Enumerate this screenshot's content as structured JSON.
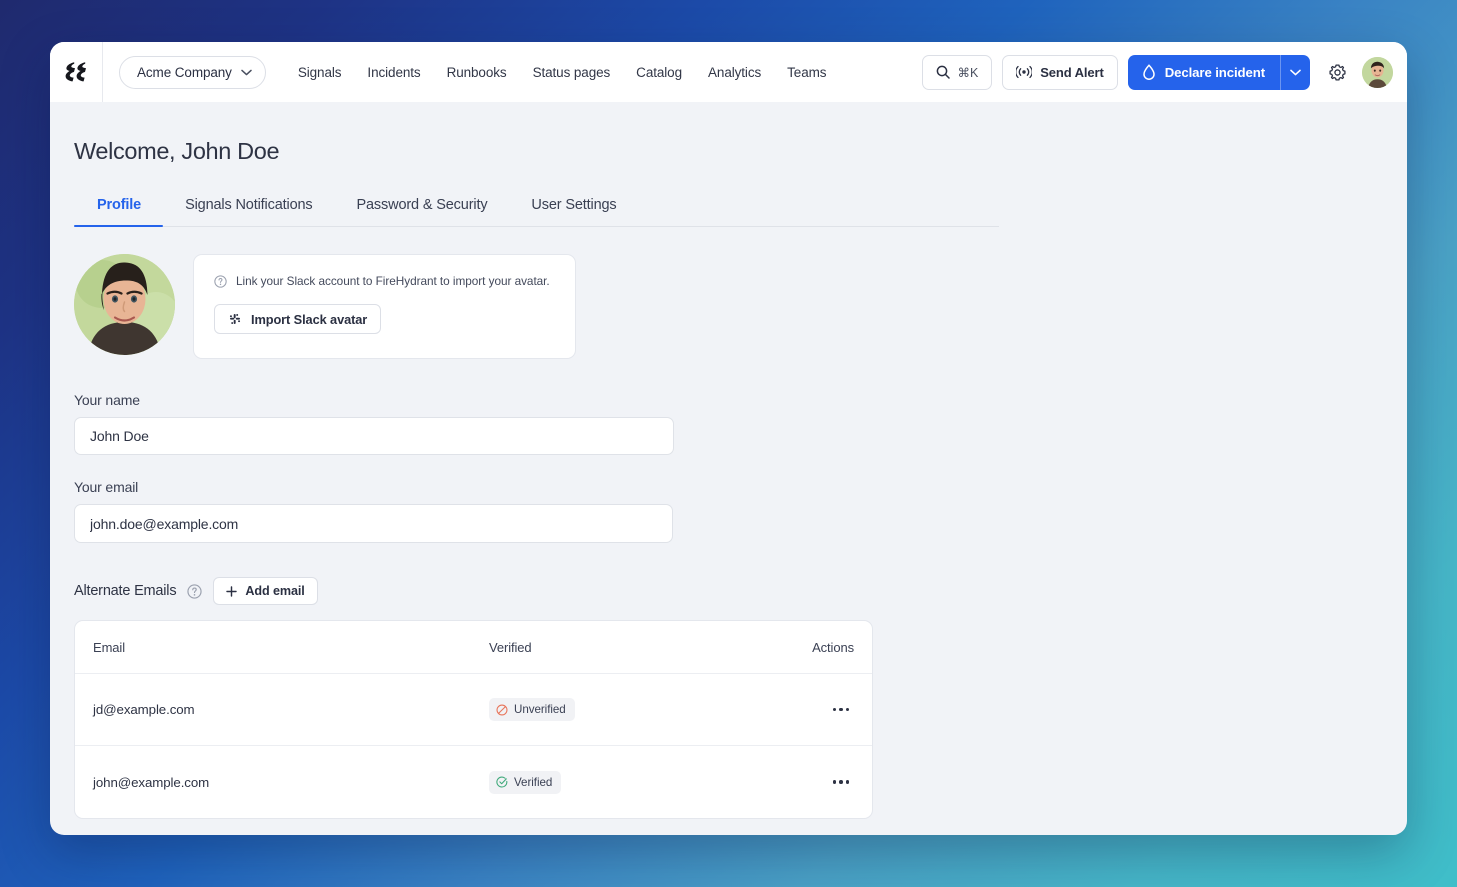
{
  "topnav": {
    "logo_name": "firehydrant-logo",
    "org_switcher": {
      "label": "Acme Company",
      "caret_icon": "chevron-down-icon"
    },
    "links": [
      {
        "label": "Signals"
      },
      {
        "label": "Incidents"
      },
      {
        "label": "Runbooks"
      },
      {
        "label": "Status pages"
      },
      {
        "label": "Catalog"
      },
      {
        "label": "Analytics"
      },
      {
        "label": "Teams"
      }
    ],
    "search": {
      "icon": "search-icon",
      "shortcut": "⌘K"
    },
    "send_alert": {
      "icon": "broadcast-icon",
      "label": "Send Alert"
    },
    "declare_incident": {
      "icon": "droplet-icon",
      "label": "Declare incident",
      "caret_icon": "chevron-down-icon",
      "accent_color": "#2563eb"
    },
    "settings": {
      "icon": "gear-icon"
    },
    "user_avatar": {
      "icon": "avatar"
    }
  },
  "page": {
    "title": "Welcome, John Doe",
    "tabs": [
      {
        "label": "Profile",
        "active": true
      },
      {
        "label": "Signals Notifications",
        "active": false
      },
      {
        "label": "Password & Security",
        "active": false
      },
      {
        "label": "User Settings",
        "active": false
      }
    ]
  },
  "avatar_section": {
    "avatar_name": "profile-avatar",
    "note_icon": "help-circle-icon",
    "note": "Link your Slack account to FireHydrant to import your avatar.",
    "import_button": {
      "icon": "slack-icon",
      "label": "Import Slack avatar"
    }
  },
  "form": {
    "name": {
      "label": "Your name",
      "value": "John Doe",
      "placeholder": "Your name"
    },
    "email": {
      "label": "Your email",
      "value": "john.doe@example.com",
      "placeholder": "Your email"
    }
  },
  "alternate_emails": {
    "title": "Alternate Emails",
    "help_icon": "help-circle-icon",
    "add_button": {
      "icon": "plus-icon",
      "label": "Add email"
    },
    "columns": [
      "Email",
      "Verified",
      "Actions"
    ],
    "rows": [
      {
        "email": "jd@example.com",
        "status": "Unverified",
        "status_icon": "no-entry-icon",
        "status_color": "#e8765c",
        "actions_icon": "ellipsis-icon"
      },
      {
        "email": "john@example.com",
        "status": "Verified",
        "status_icon": "check-circle-icon",
        "status_color": "#3fa97a",
        "actions_icon": "ellipsis-icon"
      }
    ]
  }
}
